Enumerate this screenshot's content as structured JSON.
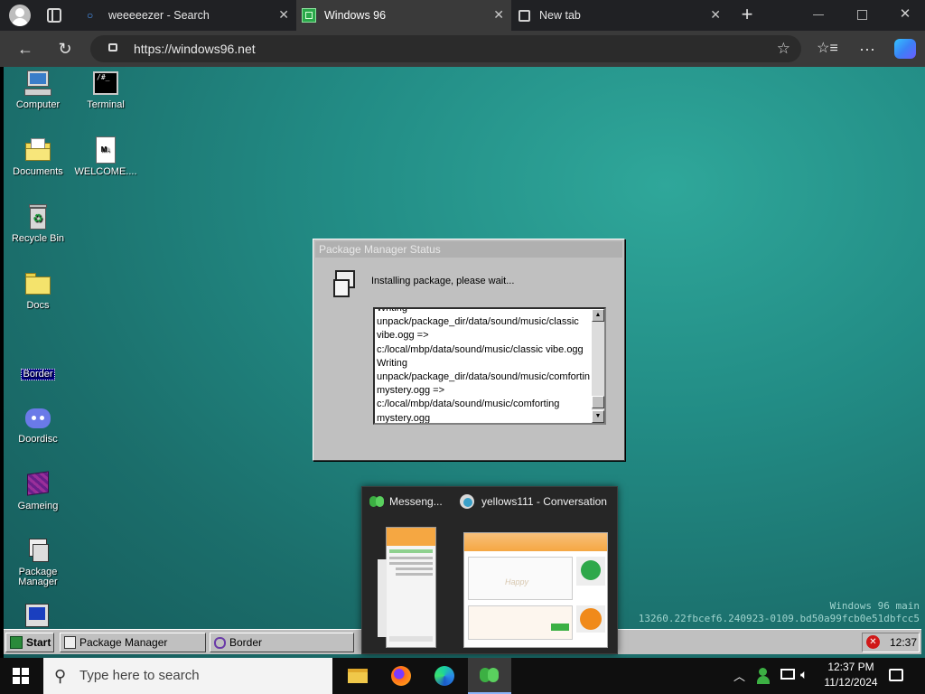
{
  "browser": {
    "tabs": [
      {
        "label": "weeeeezer - Search",
        "icon": "search-icon"
      },
      {
        "label": "Windows 96",
        "icon": "windows96-icon"
      },
      {
        "label": "New tab",
        "icon": "newtab-icon"
      }
    ],
    "url": "https://windows96.net"
  },
  "desktop": {
    "icons": [
      {
        "label": "Computer",
        "icon": "computer-icon"
      },
      {
        "label": "Terminal",
        "icon": "terminal-icon"
      },
      {
        "label": "Documents",
        "icon": "documents-folder-icon"
      },
      {
        "label": "WELCOME....",
        "icon": "markdown-file-icon"
      },
      {
        "label": "Recycle Bin",
        "icon": "recycle-bin-icon"
      },
      {
        "label": "Docs",
        "icon": "folder-icon"
      },
      {
        "label": "Border",
        "icon": "none"
      },
      {
        "label": "Doordisc",
        "icon": "discord-icon"
      },
      {
        "label": "Gameing",
        "icon": "cube-icon"
      },
      {
        "label": "Package Manager",
        "icon": "package-manager-icon"
      }
    ],
    "watermark_line1": "Windows 96 main",
    "watermark_line2": "13260.22fbcef6.240923-0109.bd50a99fcb0e51dbfcc5"
  },
  "package_dialog": {
    "title": "Package Manager Status",
    "message": "Installing package, please wait...",
    "log": [
      "Writing",
      "unpack/package_dir/data/sound/music/classic",
      "vibe.ogg =>",
      "c:/local/mbp/data/sound/music/classic vibe.ogg",
      "Writing",
      "unpack/package_dir/data/sound/music/comfortin",
      "mystery.ogg =>",
      "c:/local/mbp/data/sound/music/comforting",
      "mystery.ogg"
    ]
  },
  "w96_taskbar": {
    "start": "Start",
    "items": [
      "Package Manager",
      "Border"
    ],
    "time": "12:37"
  },
  "preview": {
    "items": [
      {
        "title": "Messeng...",
        "icon": "messenger-icon"
      },
      {
        "title": "yellows111 - Conversation",
        "icon": "messenger-conversation-icon"
      }
    ],
    "thumb_text": "Happy"
  },
  "win_taskbar": {
    "search_placeholder": "Type here to search",
    "time": "12:37 PM",
    "date": "11/12/2024"
  },
  "colors": {
    "desktop": "#228c85",
    "edge_accent": "#3b82f6",
    "dialog_face": "#c0c0c0",
    "messenger_orange": "#f5a742"
  }
}
